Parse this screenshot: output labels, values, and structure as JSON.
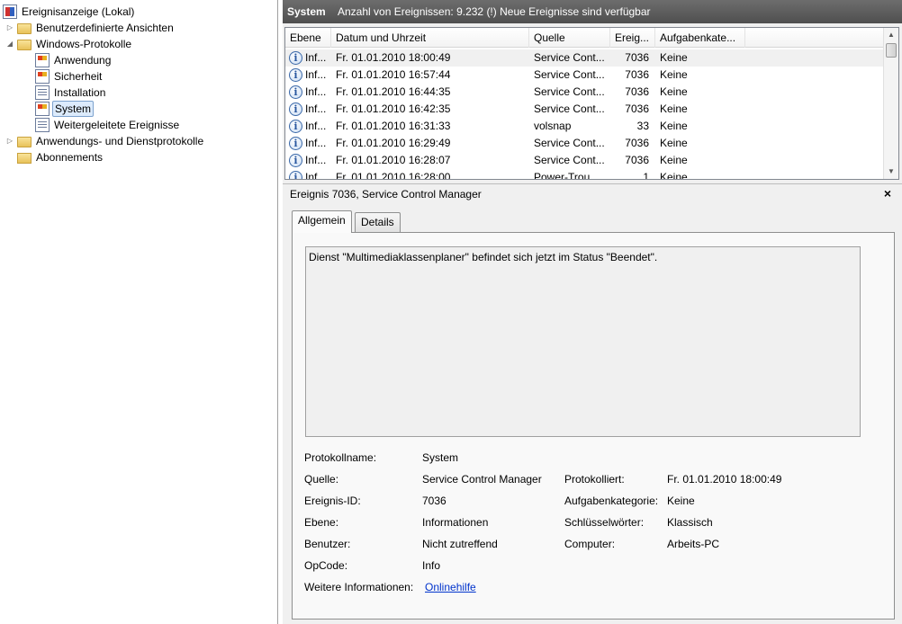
{
  "tree": {
    "root": "Ereignisanzeige (Lokal)",
    "items": [
      {
        "label": "Benutzerdefinierte Ansichten"
      },
      {
        "label": "Windows-Protokolle"
      },
      {
        "label": "Anwendung"
      },
      {
        "label": "Sicherheit"
      },
      {
        "label": "Installation"
      },
      {
        "label": "System"
      },
      {
        "label": "Weitergeleitete Ereignisse"
      },
      {
        "label": "Anwendungs- und Dienstprotokolle"
      },
      {
        "label": "Abonnements"
      }
    ]
  },
  "header": {
    "log_name": "System",
    "event_count": "Anzahl von Ereignissen: 9.232 (!) Neue Ereignisse sind verfügbar"
  },
  "table": {
    "columns": [
      "Ebene",
      "Datum und Uhrzeit",
      "Quelle",
      "Ereig...",
      "Aufgabenkate..."
    ],
    "rows": [
      [
        "Inf...",
        "Fr. 01.01.2010 18:00:49",
        "Service Cont...",
        "7036",
        "Keine"
      ],
      [
        "Inf...",
        "Fr. 01.01.2010 16:57:44",
        "Service Cont...",
        "7036",
        "Keine"
      ],
      [
        "Inf...",
        "Fr. 01.01.2010 16:44:35",
        "Service Cont...",
        "7036",
        "Keine"
      ],
      [
        "Inf...",
        "Fr. 01.01.2010 16:42:35",
        "Service Cont...",
        "7036",
        "Keine"
      ],
      [
        "Inf...",
        "Fr. 01.01.2010 16:31:33",
        "volsnap",
        "33",
        "Keine"
      ],
      [
        "Inf...",
        "Fr. 01.01.2010 16:29:49",
        "Service Cont...",
        "7036",
        "Keine"
      ],
      [
        "Inf...",
        "Fr. 01.01.2010 16:28:07",
        "Service Cont...",
        "7036",
        "Keine"
      ],
      [
        "Inf...",
        "Fr. 01.01.2010 16:28:00",
        "Power-Trou...",
        "1",
        "Keine"
      ]
    ]
  },
  "detail": {
    "title": "Ereignis 7036, Service Control Manager",
    "close": "×",
    "tabs": [
      "Allgemein",
      "Details"
    ],
    "description": "Dienst \"Multimediaklassenplaner\" befindet sich jetzt im Status \"Beendet\".",
    "fields": {
      "protokollname_label": "Protokollname:",
      "protokollname": "System",
      "quelle_label": "Quelle:",
      "quelle": "Service Control Manager",
      "protokolliert_label": "Protokolliert:",
      "protokolliert": "Fr. 01.01.2010 18:00:49",
      "ereignis_id_label": "Ereignis-ID:",
      "ereignis_id": "7036",
      "aufgabenkategorie_label": "Aufgabenkategorie:",
      "aufgabenkategorie": "Keine",
      "ebene_label": "Ebene:",
      "ebene": "Informationen",
      "schluesselwoerter_label": "Schlüsselwörter:",
      "schluesselwoerter": "Klassisch",
      "benutzer_label": "Benutzer:",
      "benutzer": "Nicht zutreffend",
      "computer_label": "Computer:",
      "computer": "Arbeits-PC",
      "opcode_label": "OpCode:",
      "opcode": "Info",
      "weitere_label": "Weitere Informationen:",
      "weitere_link": "Onlinehilfe"
    }
  }
}
